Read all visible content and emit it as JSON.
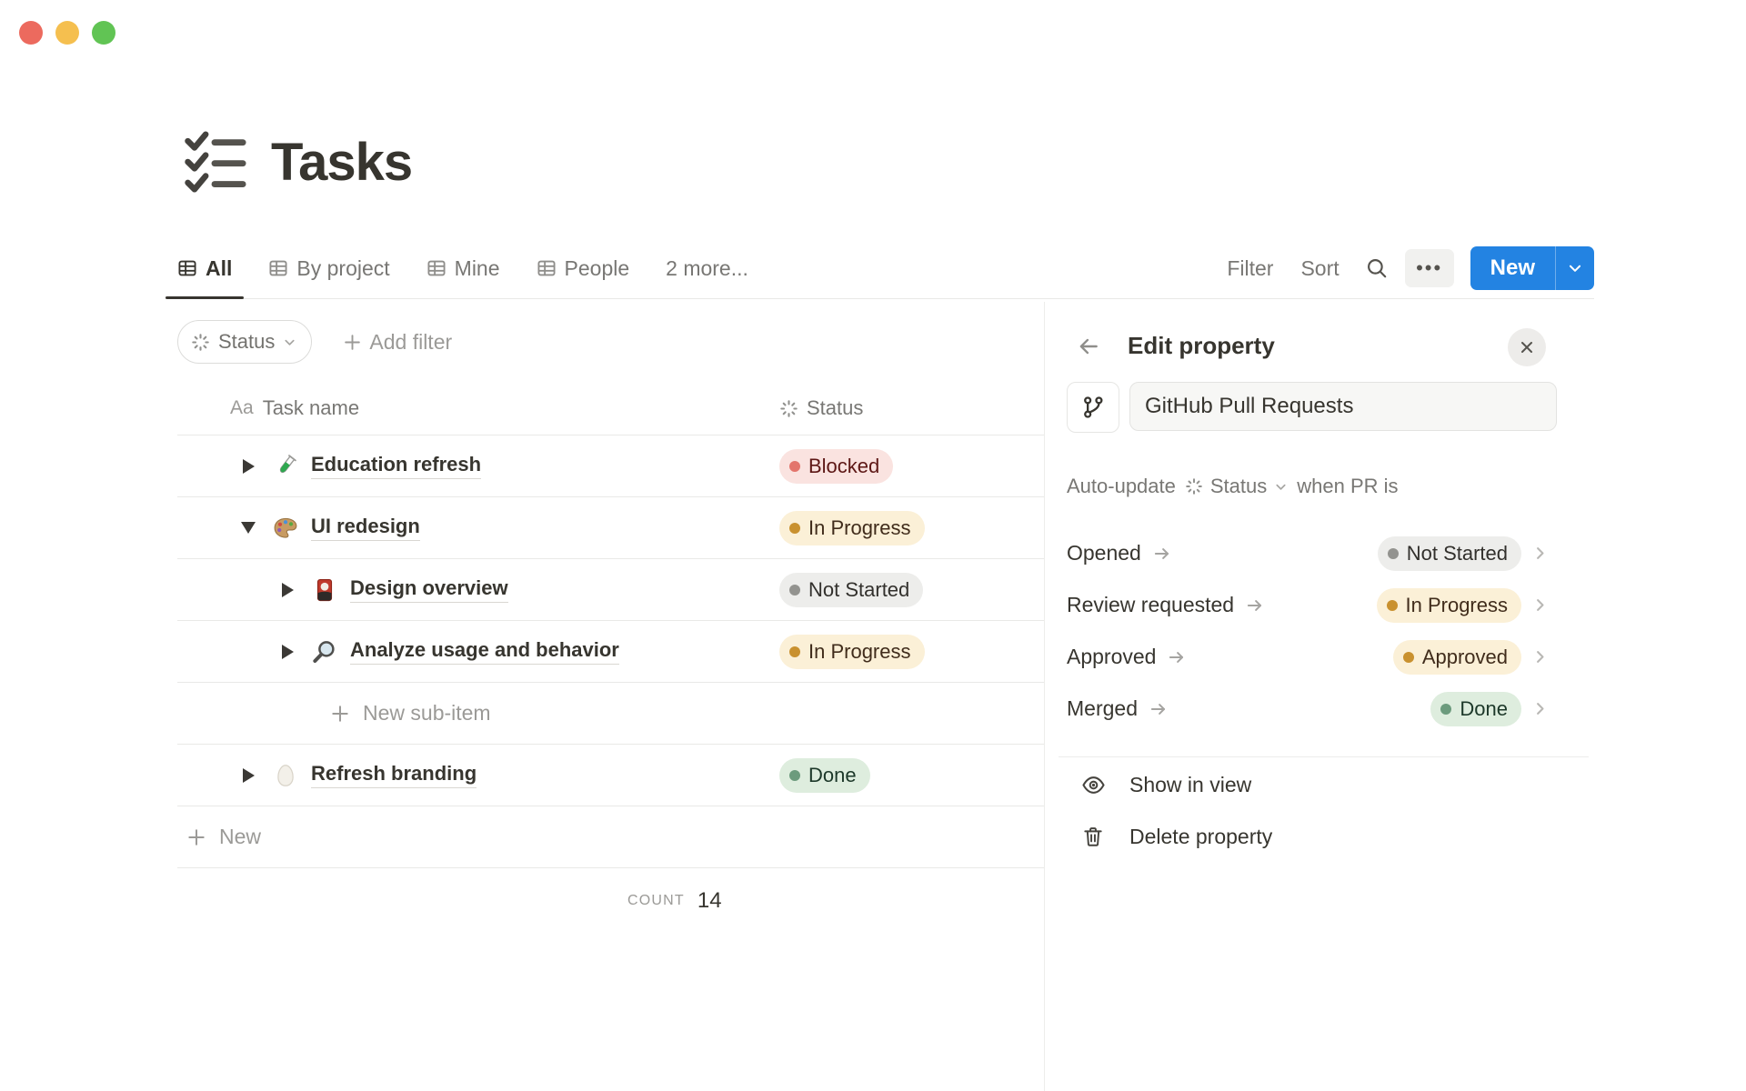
{
  "page": {
    "title": "Tasks",
    "icon": "checklist-icon"
  },
  "tabs": [
    {
      "label": "All",
      "icon": "table-view-icon",
      "active": true
    },
    {
      "label": "By project",
      "icon": "table-view-icon",
      "active": false
    },
    {
      "label": "Mine",
      "icon": "table-view-icon",
      "active": false
    },
    {
      "label": "People",
      "icon": "table-view-icon",
      "active": false
    },
    {
      "label": "2 more...",
      "icon": null,
      "active": false
    }
  ],
  "toolbar": {
    "filter_label": "Filter",
    "sort_label": "Sort",
    "search_icon": "search-icon",
    "more_icon": "ellipsis-icon",
    "new_label": "New",
    "accent_color": "#2383E2"
  },
  "filter_bar": {
    "status_filter_label": "Status",
    "add_filter_label": "Add filter"
  },
  "table": {
    "columns": [
      {
        "label": "Task name",
        "icon": "Aa"
      },
      {
        "label": "Status",
        "icon": "status-burst-icon"
      }
    ],
    "rows": [
      {
        "name": "Education refresh",
        "icon": "test-tube-emoji",
        "level": 0,
        "expanded": false,
        "status": {
          "label": "Blocked",
          "color": "red"
        }
      },
      {
        "name": "UI redesign",
        "icon": "palette-emoji",
        "level": 0,
        "expanded": true,
        "status": {
          "label": "In Progress",
          "color": "yellow"
        }
      },
      {
        "name": "Design overview",
        "icon": "flower-card-emoji",
        "level": 1,
        "expanded": false,
        "status": {
          "label": "Not Started",
          "color": "gray"
        }
      },
      {
        "name": "Analyze usage and behavior",
        "icon": "magnifier-emoji",
        "level": 1,
        "expanded": false,
        "status": {
          "label": "In Progress",
          "color": "yellow"
        }
      },
      {
        "name": "Refresh branding",
        "icon": "egg-emoji",
        "level": 0,
        "expanded": false,
        "status": {
          "label": "Done",
          "color": "green"
        }
      }
    ],
    "new_sub_item_label": "New sub-item",
    "new_row_label": "New",
    "footer": {
      "count_label": "COUNT",
      "count_value": "14"
    }
  },
  "panel": {
    "back_icon": "arrow-left-icon",
    "title": "Edit property",
    "close_icon": "close-icon",
    "property_icon": "git-pull-request-icon",
    "name_value": "GitHub Pull Requests",
    "auto_update": {
      "prefix": "Auto-update",
      "property_icon": "status-burst-icon",
      "property_name": "Status",
      "suffix": "when PR is"
    },
    "mappings": [
      {
        "event": "Opened",
        "status": {
          "label": "Not Started",
          "color": "gray"
        }
      },
      {
        "event": "Review requested",
        "status": {
          "label": "In Progress",
          "color": "yellow"
        }
      },
      {
        "event": "Approved",
        "status": {
          "label": "Approved",
          "color": "yellow"
        }
      },
      {
        "event": "Merged",
        "status": {
          "label": "Done",
          "color": "green"
        }
      }
    ],
    "actions": [
      {
        "label": "Show in view",
        "icon": "eye-icon"
      },
      {
        "label": "Delete property",
        "icon": "trash-icon"
      }
    ]
  },
  "status_colors": {
    "red": {
      "bg": "#FAE3E0",
      "dot": "#E3756C",
      "text": "#5D1715"
    },
    "yellow": {
      "bg": "#FBF0D7",
      "dot": "#C9912F",
      "text": "#402C1B"
    },
    "gray": {
      "bg": "#EDEDEB",
      "dot": "#93938F",
      "text": "#32302C"
    },
    "green": {
      "bg": "#DEEDDE",
      "dot": "#6C9B7D",
      "text": "#1C3829"
    }
  }
}
